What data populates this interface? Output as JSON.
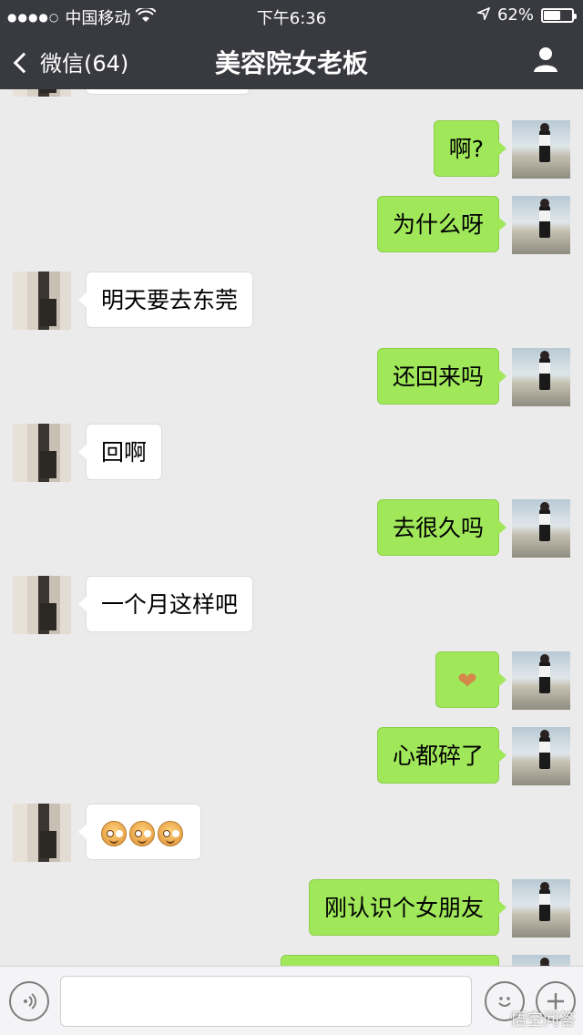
{
  "status_bar": {
    "carrier": "中国移动",
    "time": "下午6:36",
    "battery": "62%",
    "battery_level": 0.62
  },
  "nav": {
    "back_label": "微信(64)",
    "title": "美容院女老板"
  },
  "messages": [
    {
      "side": "right",
      "text": "啊?"
    },
    {
      "side": "right",
      "text": "为什么呀"
    },
    {
      "side": "left",
      "text": "明天要去东莞"
    },
    {
      "side": "right",
      "text": "还回来吗"
    },
    {
      "side": "left",
      "text": "回啊"
    },
    {
      "side": "right",
      "text": "去很久吗"
    },
    {
      "side": "left",
      "text": "一个月这样吧"
    },
    {
      "side": "right",
      "text": "",
      "emoji": "heart"
    },
    {
      "side": "right",
      "text": "心都碎了"
    },
    {
      "side": "left",
      "text": "",
      "emoji": "laugh-x3"
    },
    {
      "side": "right",
      "text": "刚认识个女朋友"
    }
  ],
  "input_bar": {
    "text_value": "",
    "watermark": "悟空问答"
  },
  "colors": {
    "nav_bg": "#393a3f",
    "chat_bg": "#ebebeb",
    "my_bubble": "#a0e75a",
    "their_bubble": "#ffffff"
  }
}
